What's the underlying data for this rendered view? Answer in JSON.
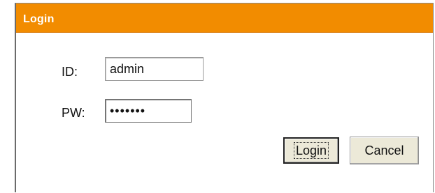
{
  "dialog": {
    "title": "Login",
    "accent_color": "#f28c00"
  },
  "form": {
    "id_label": "ID:",
    "id_value": "admin",
    "pw_label": "PW:",
    "pw_value": "•••••••"
  },
  "buttons": {
    "login_label": "Login",
    "cancel_label": "Cancel"
  }
}
